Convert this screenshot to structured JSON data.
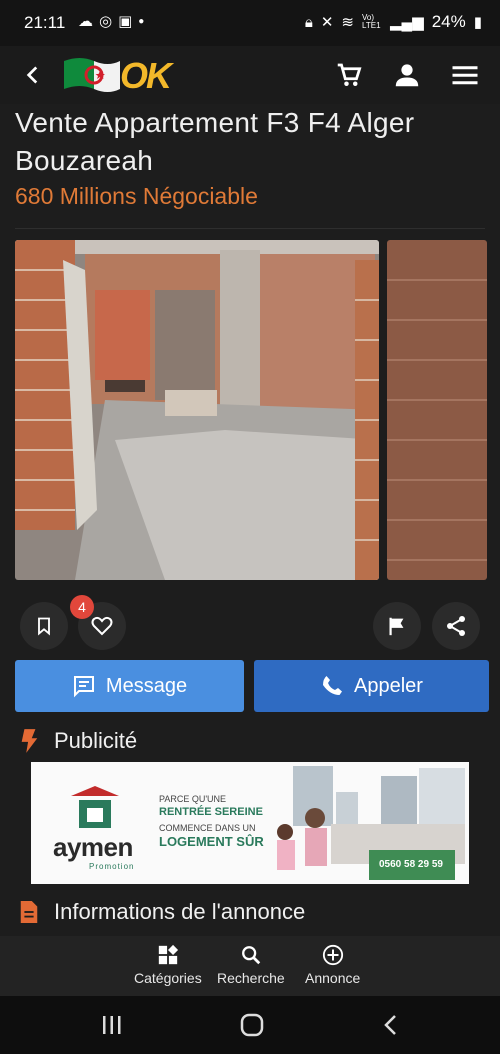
{
  "status_bar": {
    "time": "21:11",
    "battery_text": "24%",
    "signal_text": "Vo) LTE1"
  },
  "app_bar": {
    "logo_text": "OK"
  },
  "listing": {
    "title": "Vente Appartement F3 F4 Alger Bouzareah",
    "price": "680 Millions Négociable",
    "like_count": "4"
  },
  "actions": {
    "message_label": "Message",
    "call_label": "Appeler"
  },
  "sections": {
    "ad_title": "Publicité",
    "info_title": "Informations de l'annonce"
  },
  "ad": {
    "brand": "aymen",
    "brand_sub": "Promotion",
    "line1": "PARCE QU'UNE",
    "line2": "RENTRÉE SEREINE",
    "line3": "COMMENCE DANS UN",
    "line4": "LOGEMENT SÛR",
    "phone": "0560 58 29 59"
  },
  "bottom_nav": {
    "items": [
      {
        "label": "Catégories",
        "icon": "widgets-icon"
      },
      {
        "label": "Recherche",
        "icon": "search-icon"
      },
      {
        "label": "Annonce",
        "icon": "add-circle-icon"
      }
    ]
  },
  "colors": {
    "accent_price": "#e07a37",
    "message_btn": "#4a8fe0",
    "call_btn": "#2f6bc2",
    "badge": "#e1473b"
  }
}
